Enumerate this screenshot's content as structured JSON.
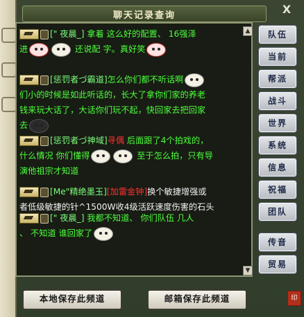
{
  "window": {
    "title": "聊天记录查询",
    "close_label": "X"
  },
  "messages": [
    {
      "name": "[\" 夜晨_] ",
      "lines": [
        [
          {
            "t": "拿着 这么好的配置、 16强泽",
            "c": "c-green"
          }
        ],
        [
          {
            "t": "进",
            "c": "c-green"
          },
          {
            "emoji": "red"
          },
          {
            "emoji": "white"
          },
          {
            "t": " 还说配 字。真好笑",
            "c": "c-green"
          },
          {
            "emoji": "red"
          }
        ]
      ]
    },
    {
      "name": "[惩罚者づ霸道]",
      "lines": [
        [
          {
            "t": "怎么你们都不听话啊",
            "c": "c-green"
          },
          {
            "emoji": "white"
          }
        ],
        [
          {
            "t": "们小的时候是如此听话的，长大了拿你们家的养老",
            "c": "c-green"
          }
        ],
        [
          {
            "t": "钱来玩大话了，大话你们玩不起，快回家去把回家",
            "c": "c-green"
          }
        ],
        [
          {
            "t": "去",
            "c": "c-green"
          },
          {
            "emoji": "dark"
          }
        ]
      ]
    },
    {
      "name": "[惩罚者づ神域]",
      "lines": [
        [
          {
            "t": "寻偶",
            "c": "c-red"
          },
          {
            "t": " 后面跟了4个拍戏的，",
            "c": "c-green"
          }
        ],
        [
          {
            "t": "什么情况 你们懂得",
            "c": "c-green"
          },
          {
            "emoji": "white"
          },
          {
            "emoji": "white"
          },
          {
            "t": " 至于怎么拍，只有导",
            "c": "c-green"
          }
        ],
        [
          {
            "t": "演他祖宗才知道",
            "c": "c-green"
          }
        ]
      ]
    },
    {
      "name": "[Me\"精绝墨玉]",
      "lines": [
        [
          {
            "t": "[加雷金钟]",
            "c": "c-red"
          },
          {
            "t": "换个敏捷增强或",
            "c": "c-white"
          }
        ],
        [
          {
            "t": "者低级敏捷的针^1500W收4级活跃速度伤害的石头",
            "c": "c-white"
          }
        ]
      ]
    },
    {
      "name": "[\" 夜晨_] ",
      "lines": [
        [
          {
            "t": "我都不知道、 你们队伍 几人",
            "c": "c-green"
          }
        ],
        [
          {
            "t": "、 不知道 谁回家了",
            "c": "c-green"
          },
          {
            "emoji": "white"
          }
        ]
      ]
    }
  ],
  "sidebar": {
    "buttons": [
      "队伍",
      "当前",
      "帮派",
      "战斗",
      "世界",
      "系统",
      "信息",
      "祝福",
      "团队",
      "传音",
      "贸易"
    ]
  },
  "bottom": {
    "save_local": "本地保存此频道",
    "save_mail": "邮箱保存此频道"
  },
  "stamp_text": "印",
  "colors": {
    "chat_bg": "#181c14",
    "green_text": "#4cff3c",
    "red_text": "#ff3030"
  }
}
